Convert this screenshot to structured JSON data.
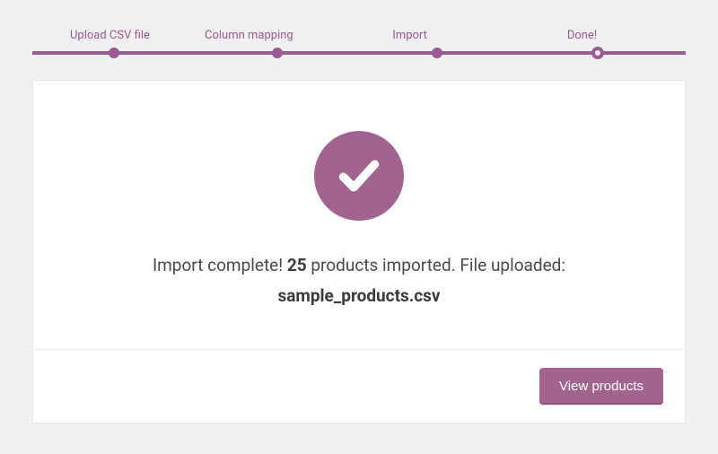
{
  "progress": {
    "steps": [
      {
        "label": "Upload CSV file",
        "position": 12.5
      },
      {
        "label": "Column mapping",
        "position": 37.5
      },
      {
        "label": "Import",
        "position": 62
      },
      {
        "label": "Done!",
        "position": 86.5
      }
    ],
    "current_index": 3
  },
  "result": {
    "message_prefix": "Import complete! ",
    "count": "25",
    "message_middle": " products imported. File uploaded:",
    "filename": "sample_products.csv"
  },
  "actions": {
    "view_products_label": "View products"
  },
  "colors": {
    "accent": "#A2648F"
  }
}
